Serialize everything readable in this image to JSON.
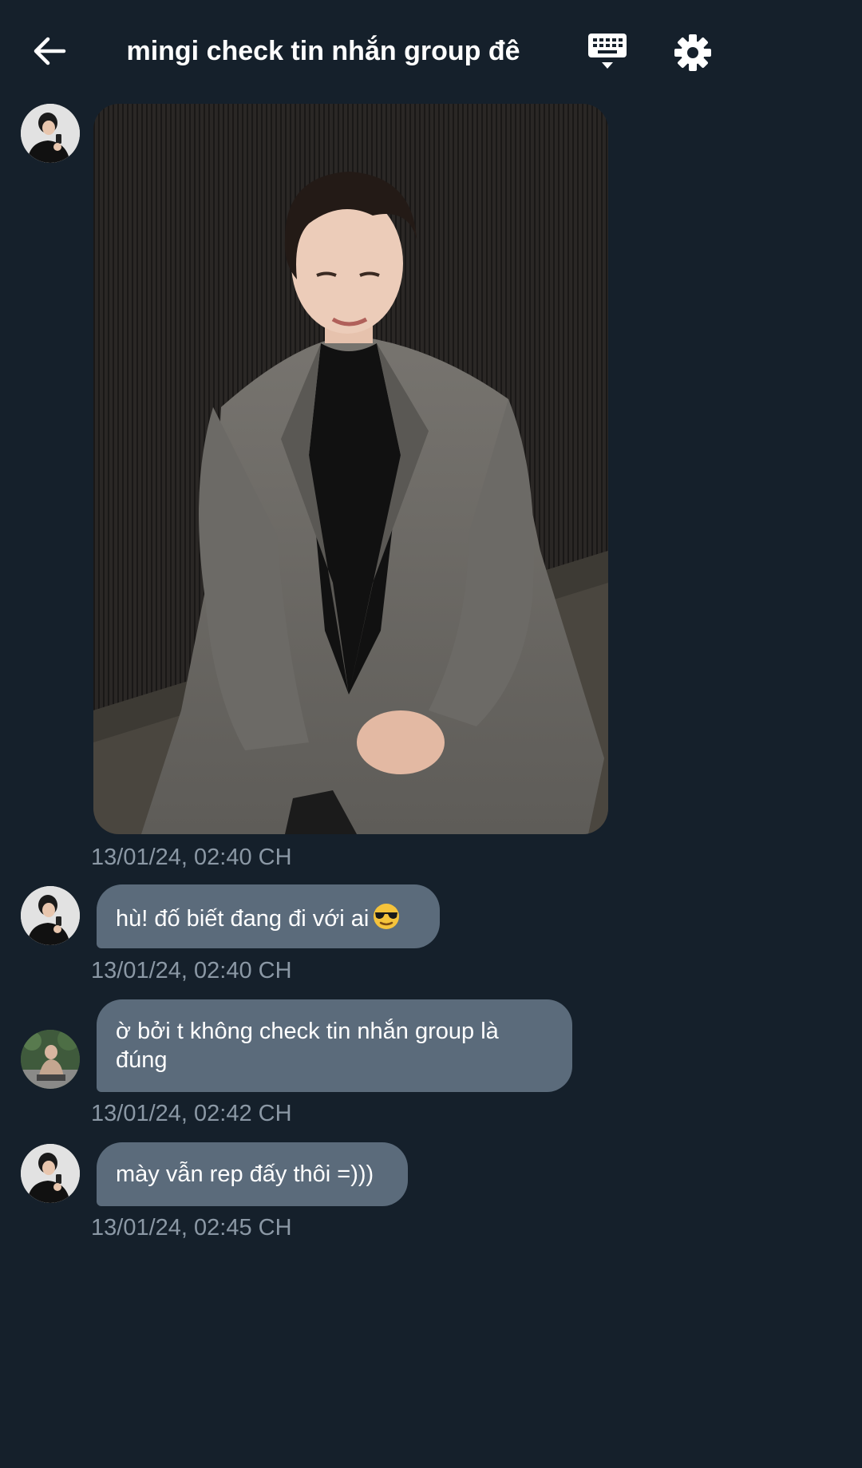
{
  "header": {
    "title": "mingi check tin nhắn group đê",
    "back_icon": "arrow-left-icon",
    "keyboard_icon": "keyboard-icon",
    "settings_icon": "gear-icon"
  },
  "messages": [
    {
      "type": "image",
      "timestamp": "13/01/24, 02:40 CH"
    },
    {
      "type": "text",
      "text": "hù! đố biết đang đi với ai",
      "emoji": "sunglasses-emoji",
      "timestamp": "13/01/24, 02:40 CH"
    },
    {
      "type": "text",
      "text": "ờ bởi t không check tin nhắn group là đúng",
      "timestamp": "13/01/24, 02:42 CH"
    },
    {
      "type": "text",
      "text": "mày vẫn rep đấy thôi =)))",
      "timestamp": "13/01/24, 02:45 CH"
    }
  ],
  "colors": {
    "background": "#15202b",
    "bubble": "#5b6b7b",
    "timestamp": "#8b98a5",
    "text": "#ffffff"
  }
}
